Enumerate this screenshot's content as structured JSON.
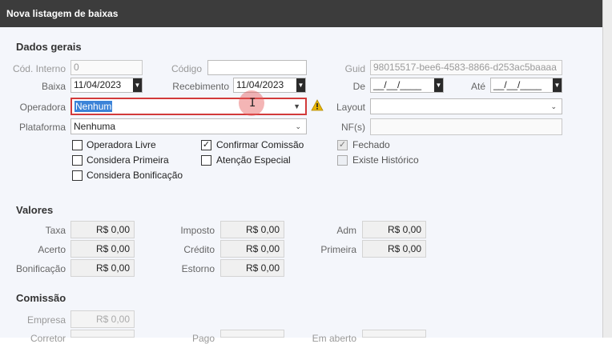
{
  "window": {
    "title": "Nova listagem de baixas"
  },
  "dados_gerais": {
    "heading": "Dados gerais",
    "cod_interno": {
      "label": "Cód. Interno",
      "value": "0"
    },
    "codigo": {
      "label": "Código",
      "value": ""
    },
    "guid": {
      "label": "Guid",
      "value": "98015517-bee6-4583-8866-d253ac5baaaa"
    },
    "baixa": {
      "label": "Baixa",
      "value": "11/04/2023"
    },
    "recebimento": {
      "label": "Recebimento",
      "value": "11/04/2023"
    },
    "de": {
      "label": "De",
      "value": "__/__/____"
    },
    "ate": {
      "label": "Até",
      "value": "__/__/____"
    },
    "operadora": {
      "label": "Operadora",
      "value": "Nenhum"
    },
    "layout": {
      "label": "Layout",
      "value": ""
    },
    "plataforma": {
      "label": "Plataforma",
      "value": "Nenhuma"
    },
    "nfs": {
      "label": "NF(s)",
      "value": ""
    },
    "checkboxes": {
      "operadora_livre": {
        "label": "Operadora Livre",
        "checked": false
      },
      "confirmar_comissao": {
        "label": "Confirmar Comissão",
        "checked": true,
        "mark": "✓"
      },
      "fechado": {
        "label": "Fechado",
        "checked": true,
        "mark": "✓"
      },
      "considera_primeira": {
        "label": "Considera Primeira",
        "checked": false
      },
      "atencao_especial": {
        "label": "Atenção Especial",
        "checked": false
      },
      "existe_historico": {
        "label": "Existe Histórico",
        "checked": false
      },
      "considera_bonificacao": {
        "label": "Considera Bonificação",
        "checked": false
      }
    }
  },
  "valores": {
    "heading": "Valores",
    "taxa": {
      "label": "Taxa",
      "value": "R$ 0,00"
    },
    "imposto": {
      "label": "Imposto",
      "value": "R$ 0,00"
    },
    "adm": {
      "label": "Adm",
      "value": "R$ 0,00"
    },
    "acerto": {
      "label": "Acerto",
      "value": "R$ 0,00"
    },
    "credito": {
      "label": "Crédito",
      "value": "R$ 0,00"
    },
    "primeira": {
      "label": "Primeira",
      "value": "R$ 0,00"
    },
    "bonificacao": {
      "label": "Bonificação",
      "value": "R$ 0,00"
    },
    "estorno": {
      "label": "Estorno",
      "value": "R$ 0,00"
    }
  },
  "comissao": {
    "heading": "Comissão",
    "empresa": {
      "label": "Empresa",
      "value": "R$ 0,00"
    },
    "corretor": {
      "label": "Corretor"
    },
    "pago": {
      "label": "Pago"
    },
    "em_aberto": {
      "label": "Em aberto"
    }
  },
  "icons": {
    "warning": "warning-icon",
    "dropdown": "chevron-down-icon",
    "cursor": "text-cursor-icon"
  },
  "colors": {
    "titlebar": "#3c3c3c",
    "error_border": "#d23a3a",
    "selection": "#3b83d8",
    "warning": "#e8b400"
  }
}
